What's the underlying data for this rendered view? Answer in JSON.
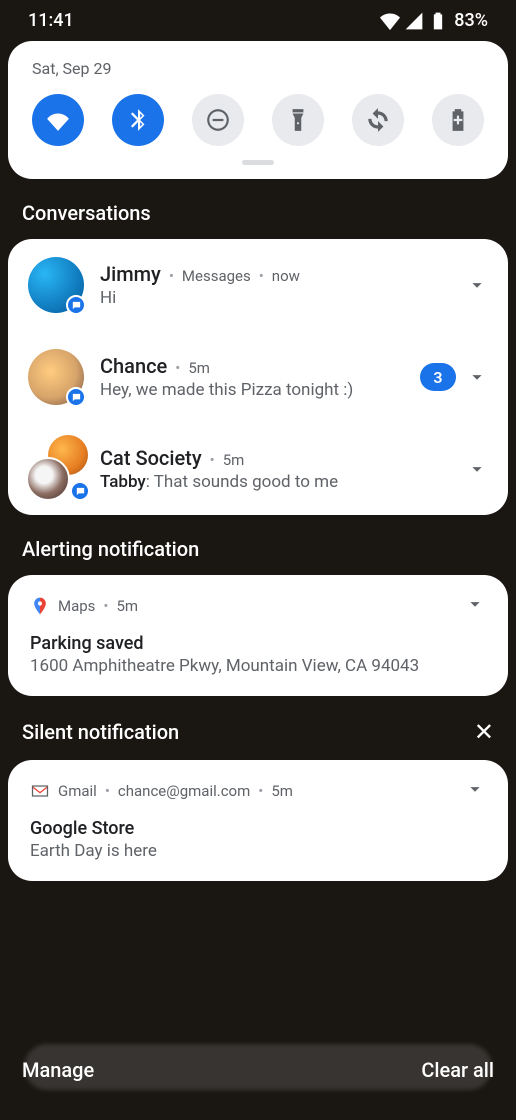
{
  "status": {
    "time": "11:41",
    "battery": "83%"
  },
  "qs": {
    "date": "Sat, Sep 29",
    "tiles": [
      {
        "name": "wifi",
        "active": true
      },
      {
        "name": "bluetooth",
        "active": true
      },
      {
        "name": "dnd",
        "active": false
      },
      {
        "name": "flashlight",
        "active": false
      },
      {
        "name": "autorotate",
        "active": false
      },
      {
        "name": "battery-saver",
        "active": false
      }
    ]
  },
  "sections": {
    "conversations": "Conversations",
    "alerting": "Alerting notification",
    "silent": "Silent notification"
  },
  "convos": [
    {
      "title": "Jimmy",
      "app": "Messages",
      "time": "now",
      "text": "Hi",
      "badge": null
    },
    {
      "title": "Chance",
      "app": null,
      "time": "5m",
      "text": "Hey, we made this Pizza tonight :)",
      "badge": "3"
    },
    {
      "title": "Cat Society",
      "app": null,
      "time": "5m",
      "sender": "Tabby",
      "text": "That sounds good to me",
      "badge": null
    }
  ],
  "maps": {
    "app": "Maps",
    "time": "5m",
    "title": "Parking saved",
    "body": "1600 Amphitheatre Pkwy, Mountain View, CA 94043"
  },
  "gmail": {
    "app": "Gmail",
    "account": "chance@gmail.com",
    "time": "5m",
    "title": "Google Store",
    "body": "Earth Day is here"
  },
  "bottom": {
    "manage": "Manage",
    "clear": "Clear all"
  }
}
